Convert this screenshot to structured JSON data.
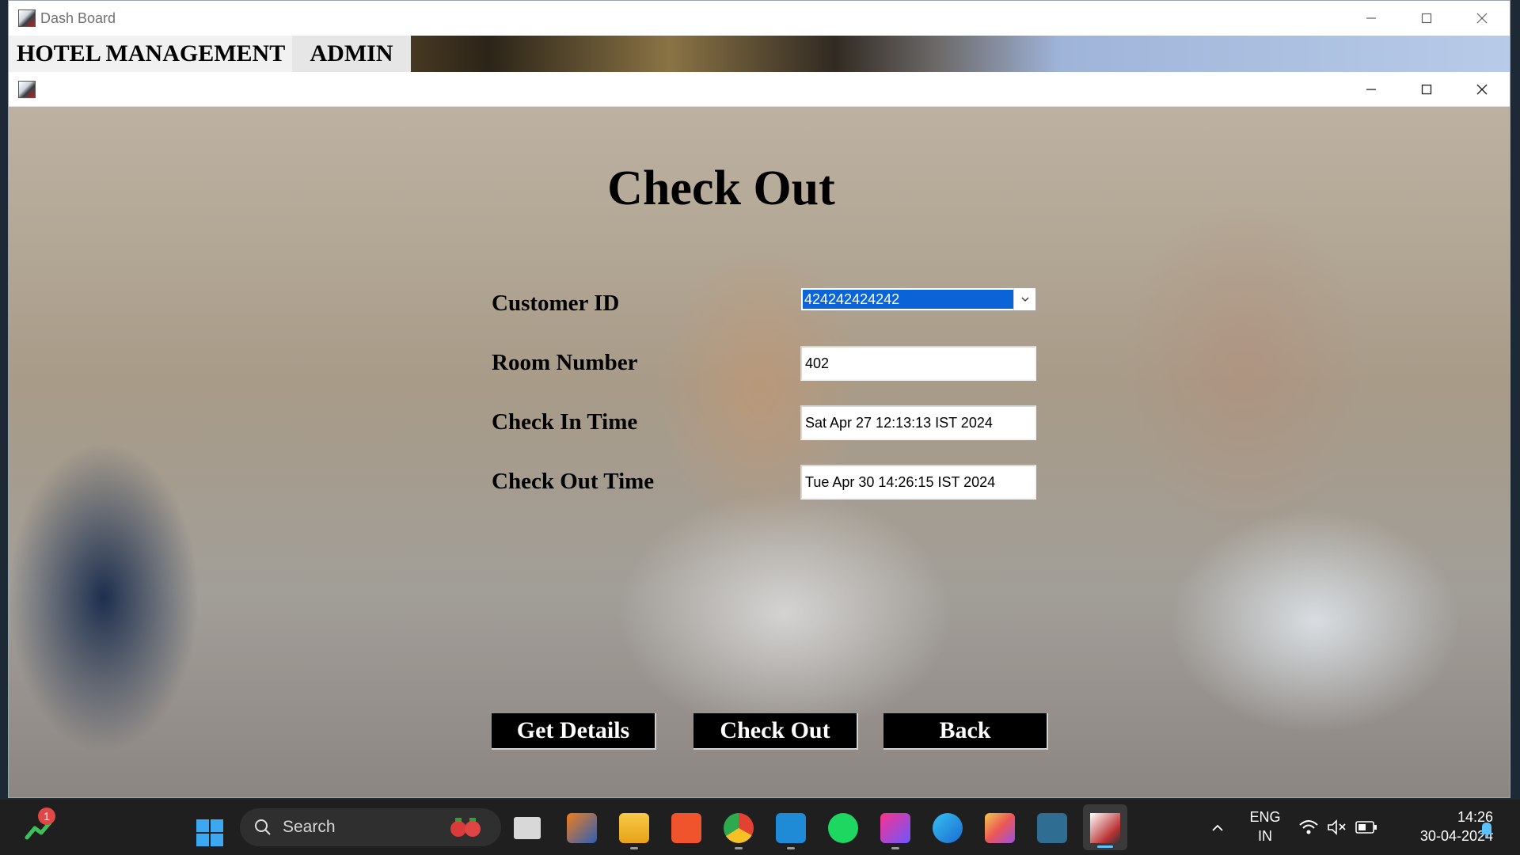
{
  "outer_window": {
    "title": "Dash Board",
    "menu": {
      "hotel_management": "HOTEL MANAGEMENT",
      "admin": "ADMIN"
    }
  },
  "checkout": {
    "heading": "Check Out",
    "labels": {
      "customer_id": "Customer ID",
      "room_number": "Room Number",
      "check_in_time": "Check In Time",
      "check_out_time": "Check Out Time"
    },
    "values": {
      "customer_id": "424242424242",
      "room_number": "402",
      "check_in_time": "Sat Apr 27 12:13:13 IST 2024",
      "check_out_time": "Tue Apr 30 14:26:15 IST 2024"
    },
    "buttons": {
      "get_details": "Get Details",
      "check_out": "Check Out",
      "back": "Back"
    }
  },
  "taskbar": {
    "search_placeholder": "Search",
    "notification_count": "1",
    "language": "ENG",
    "region": "IN",
    "time": "14:26",
    "date": "30-04-2024",
    "icons": [
      "widgets-icon",
      "start-icon",
      "search-icon",
      "task-view-icon",
      "matlab-icon",
      "file-explorer-icon",
      "brave-icon",
      "chrome-icon",
      "vscode-icon",
      "spotify-icon",
      "intellij-icon",
      "edge-icon",
      "cube-app-icon",
      "mysql-workbench-icon",
      "java-app-icon",
      "chevron-up-icon",
      "wifi-icon",
      "volume-muted-icon",
      "battery-icon",
      "bell-icon"
    ]
  },
  "colors": {
    "selection": "#0a64d8",
    "button_bg": "#000000",
    "taskbar_bg": "#1f1f1f"
  }
}
